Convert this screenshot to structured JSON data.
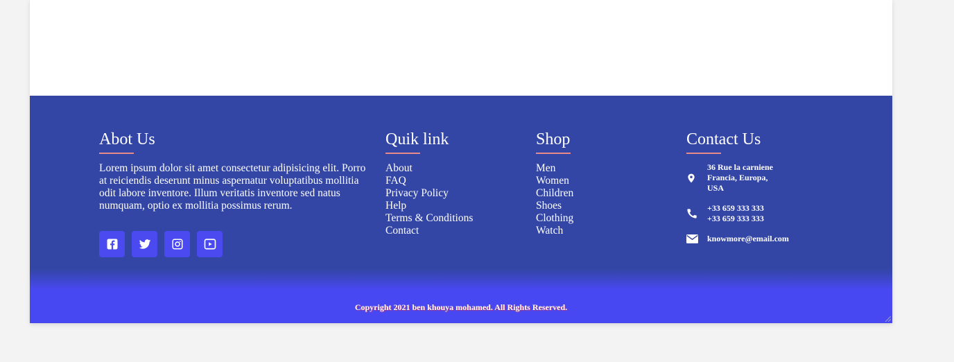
{
  "about": {
    "title": "Abot Us",
    "text": "Lorem ipsum dolor sit amet consectetur adipisicing elit. Porro at reiciendis deserunt minus aspernatur voluptatibus mollitia odit labore inventore. Illum veritatis inventore sed natus numquam, optio ex mollitia possimus rerum."
  },
  "social": [
    "facebook-icon",
    "twitter-icon",
    "instagram-icon",
    "youtube-icon"
  ],
  "quick": {
    "title": "Quik link",
    "items": [
      "About",
      "FAQ",
      "Privacy Policy",
      "Help",
      "Terms & Conditions",
      "Contact"
    ]
  },
  "shop": {
    "title": "Shop",
    "items": [
      "Men",
      "Women",
      "Children",
      "Shoes",
      "Clothing",
      "Watch"
    ]
  },
  "contact": {
    "title": "Contact Us",
    "address": [
      "36 Rue la carniene",
      "Francia, Europa,",
      "USA"
    ],
    "phones": [
      "+33 659 333 333",
      "+33 659 333 333"
    ],
    "email": "knowmore@email.com"
  },
  "copyright": "Copyright 2021 ben khouya mohamed. All Rights Reserved.",
  "colors": {
    "footer_bg": "#3346a6",
    "bottom_bg": "#4848f2",
    "social_bg": "#4a4af0",
    "accent_underline": "#e98a8a"
  }
}
